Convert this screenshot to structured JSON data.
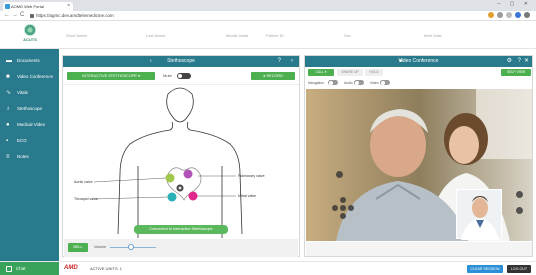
{
  "browser": {
    "tab_title": "AOMD Web Portal",
    "url": "https://agmc.dev.amdtelemedicine.com",
    "nav_back": "←",
    "nav_forward": "→",
    "nav_reload": "C"
  },
  "header": {
    "logo_text": "ACUTS",
    "fields": [
      "Short Name",
      "Last Name",
      "Middle Initial",
      "Patient ID",
      "Sex",
      "Birth Date"
    ]
  },
  "sidebar": {
    "items": [
      {
        "label": "Documents",
        "icon": "folder-icon"
      },
      {
        "label": "Video Conference",
        "icon": "video-icon"
      },
      {
        "label": "Vitals",
        "icon": "pulse-icon"
      },
      {
        "label": "Stethoscope",
        "icon": "stethoscope-icon"
      },
      {
        "label": "Medical Video",
        "icon": "camera-icon"
      },
      {
        "label": "ECG",
        "icon": "ecg-icon"
      },
      {
        "label": "Notes",
        "icon": "notes-icon"
      }
    ],
    "chat_label": "Chat"
  },
  "stethoscope_panel": {
    "title": "Stethoscope",
    "interactive_btn": "INTERACTIVE STETHOSCOPE",
    "mute_label": "Mute",
    "record_btn": "RECORD",
    "valves": {
      "aortic": "Aortic valve",
      "pulmonary": "Pulmonary valve",
      "tricuspid": "Tricuspid valve",
      "mitral": "Mitral valve"
    },
    "connect_btn": "Connected to Interactive Stethoscope",
    "bell_btn": "BELL",
    "volume_label": "Volume"
  },
  "video_panel": {
    "title": "Video Conference",
    "tabs": [
      "CALL",
      "SHARE UP",
      "HOLD"
    ],
    "self_view_btn": "SELF VIEW",
    "toggles": [
      "Navigation",
      "Audio",
      "Video"
    ]
  },
  "footer": {
    "amd_logo": "AMD",
    "active_units": "ACTIVE UNITS: 1",
    "clear_btn": "CLEAR SESSION",
    "logout_btn": "LOG OUT"
  },
  "colors": {
    "teal": "#287a8c",
    "green": "#4caf50",
    "blue": "#2d8fd6"
  }
}
